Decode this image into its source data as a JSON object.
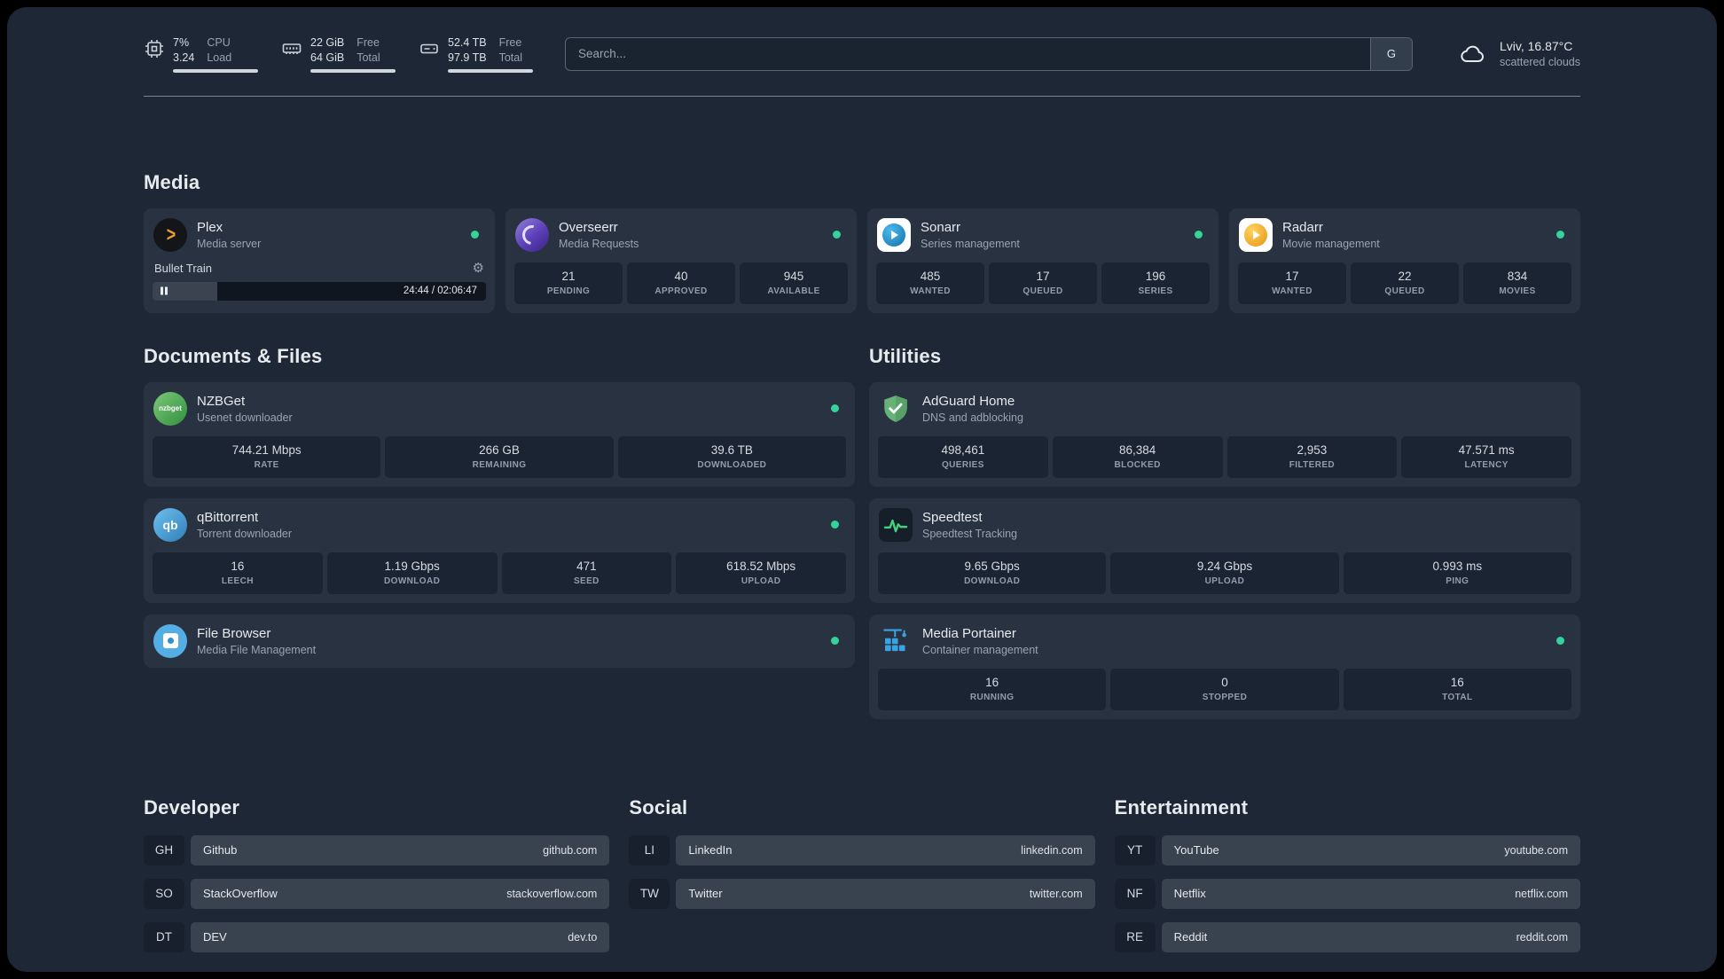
{
  "topbar": {
    "cpu": {
      "value1": "7%",
      "value2": "3.24",
      "label1": "CPU",
      "label2": "Load",
      "bar_pct": 100
    },
    "memory": {
      "value1": "22 GiB",
      "value2": "64 GiB",
      "label1": "Free",
      "label2": "Total",
      "bar_pct": 100
    },
    "disk": {
      "value1": "52.4 TB",
      "value2": "97.9 TB",
      "label1": "Free",
      "label2": "Total",
      "bar_pct": 100
    },
    "search": {
      "placeholder": "Search...",
      "button_label": "G"
    },
    "weather": {
      "location": "Lviv, 16.87°C",
      "condition": "scattered clouds"
    }
  },
  "sections": {
    "media": "Media",
    "documents": "Documents & Files",
    "utilities": "Utilities",
    "developer": "Developer",
    "social": "Social",
    "entertainment": "Entertainment"
  },
  "services": {
    "plex": {
      "name": "Plex",
      "desc": "Media server",
      "player": {
        "title": "Bullet Train",
        "time": "24:44 / 02:06:47",
        "progress_pct": 19.5
      }
    },
    "overseerr": {
      "name": "Overseerr",
      "desc": "Media Requests",
      "stats": [
        {
          "value": "21",
          "label": "PENDING"
        },
        {
          "value": "40",
          "label": "APPROVED"
        },
        {
          "value": "945",
          "label": "AVAILABLE"
        }
      ]
    },
    "sonarr": {
      "name": "Sonarr",
      "desc": "Series management",
      "stats": [
        {
          "value": "485",
          "label": "WANTED"
        },
        {
          "value": "17",
          "label": "QUEUED"
        },
        {
          "value": "196",
          "label": "SERIES"
        }
      ]
    },
    "radarr": {
      "name": "Radarr",
      "desc": "Movie management",
      "stats": [
        {
          "value": "17",
          "label": "WANTED"
        },
        {
          "value": "22",
          "label": "QUEUED"
        },
        {
          "value": "834",
          "label": "MOVIES"
        }
      ]
    },
    "nzbget": {
      "name": "NZBGet",
      "desc": "Usenet downloader",
      "stats": [
        {
          "value": "744.21 Mbps",
          "label": "RATE"
        },
        {
          "value": "266 GB",
          "label": "REMAINING"
        },
        {
          "value": "39.6 TB",
          "label": "DOWNLOADED"
        }
      ]
    },
    "qbittorrent": {
      "name": "qBittorrent",
      "desc": "Torrent downloader",
      "stats": [
        {
          "value": "16",
          "label": "LEECH"
        },
        {
          "value": "1.19 Gbps",
          "label": "DOWNLOAD"
        },
        {
          "value": "471",
          "label": "SEED"
        },
        {
          "value": "618.52 Mbps",
          "label": "UPLOAD"
        }
      ]
    },
    "filebrowser": {
      "name": "File Browser",
      "desc": "Media File Management"
    },
    "adguard": {
      "name": "AdGuard Home",
      "desc": "DNS and adblocking",
      "stats": [
        {
          "value": "498,461",
          "label": "QUERIES"
        },
        {
          "value": "86,384",
          "label": "BLOCKED"
        },
        {
          "value": "2,953",
          "label": "FILTERED"
        },
        {
          "value": "47.571 ms",
          "label": "LATENCY"
        }
      ]
    },
    "speedtest": {
      "name": "Speedtest",
      "desc": "Speedtest Tracking",
      "stats": [
        {
          "value": "9.65 Gbps",
          "label": "DOWNLOAD"
        },
        {
          "value": "9.24 Gbps",
          "label": "UPLOAD"
        },
        {
          "value": "0.993 ms",
          "label": "PING"
        }
      ]
    },
    "portainer": {
      "name": "Media Portainer",
      "desc": "Container management",
      "stats": [
        {
          "value": "16",
          "label": "RUNNING"
        },
        {
          "value": "0",
          "label": "STOPPED"
        },
        {
          "value": "16",
          "label": "TOTAL"
        }
      ]
    }
  },
  "bookmarks": {
    "developer": [
      {
        "abbr": "GH",
        "name": "Github",
        "url": "github.com"
      },
      {
        "abbr": "SO",
        "name": "StackOverflow",
        "url": "stackoverflow.com"
      },
      {
        "abbr": "DT",
        "name": "DEV",
        "url": "dev.to"
      }
    ],
    "social": [
      {
        "abbr": "LI",
        "name": "LinkedIn",
        "url": "linkedin.com"
      },
      {
        "abbr": "TW",
        "name": "Twitter",
        "url": "twitter.com"
      }
    ],
    "entertainment": [
      {
        "abbr": "YT",
        "name": "YouTube",
        "url": "youtube.com"
      },
      {
        "abbr": "NF",
        "name": "Netflix",
        "url": "netflix.com"
      },
      {
        "abbr": "RE",
        "name": "Reddit",
        "url": "reddit.com"
      }
    ]
  },
  "icons": {
    "plex_glyph": ">",
    "gear_glyph": "⚙",
    "nzbget_text": "nzbget",
    "qb_text": "qb"
  },
  "colors": {
    "background": "#1d2736",
    "status_online": "#34d399",
    "plex_accent": "#e8a12c",
    "adguard_green": "#67b279",
    "portainer_blue": "#3aa3e3",
    "speedtest_green": "#43d17e"
  }
}
